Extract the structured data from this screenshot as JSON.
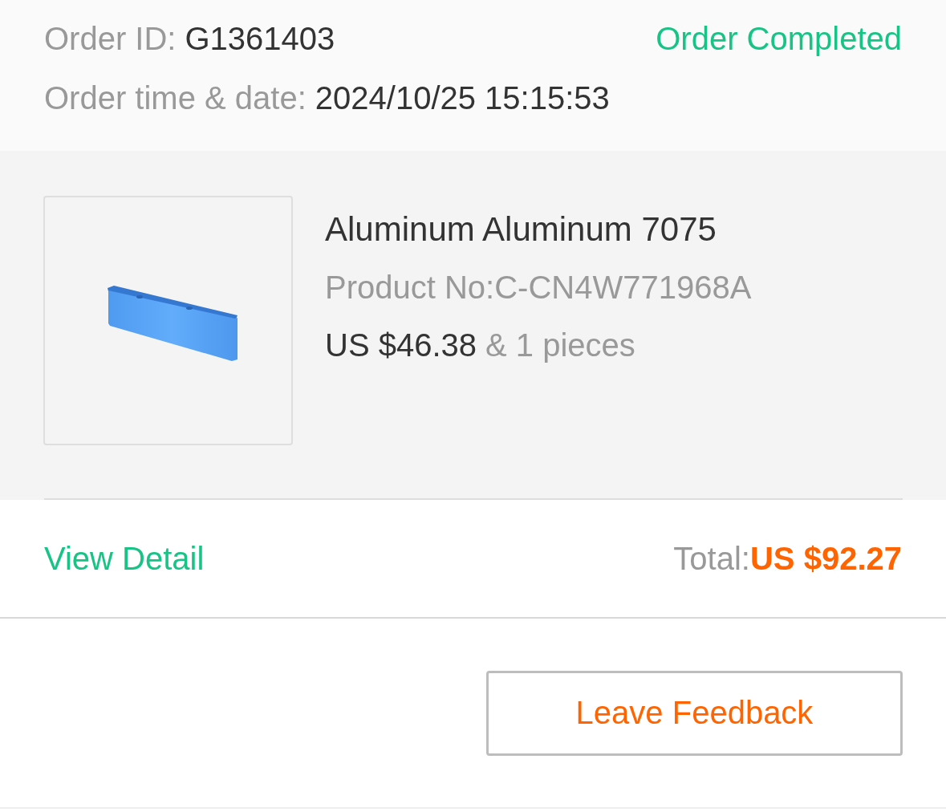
{
  "order": {
    "id_label": "Order ID:",
    "id": "G1361403",
    "status": "Order Completed",
    "time_label": "Order time & date:",
    "time": "2024/10/25 15:15:53"
  },
  "product": {
    "name": "Aluminum Aluminum 7075",
    "product_no": "Product No:C-CN4W771968A",
    "price": "US $46.38",
    "quantity": "& 1 pieces"
  },
  "footer": {
    "link": "View Detail",
    "total_label": "Total:",
    "total": "US $92.27"
  },
  "buttons": [
    "Leave Feedback"
  ]
}
